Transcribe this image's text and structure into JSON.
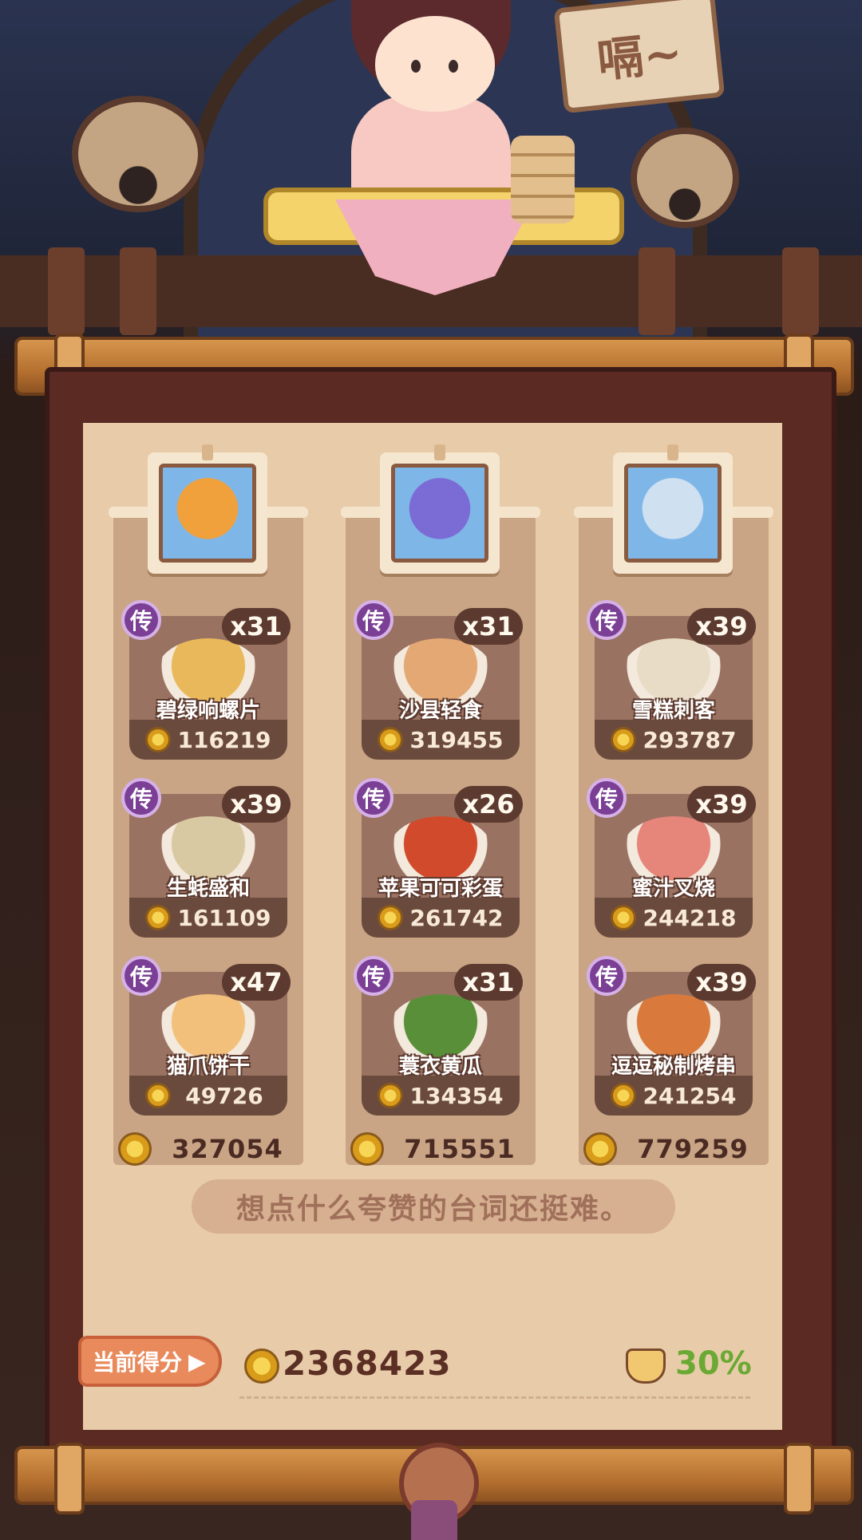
{
  "sign": {
    "text": "嗝~"
  },
  "rarity_badge": "传",
  "columns": [
    {
      "character": "bear-character",
      "total": "327054",
      "dishes": [
        {
          "name": "碧绿响螺片",
          "count": "x31",
          "price": "116219",
          "color": "#e9b85a"
        },
        {
          "name": "生蚝盛和",
          "count": "x39",
          "price": "161109",
          "color": "#d8c9a3"
        },
        {
          "name": "猫爪饼干",
          "count": "x47",
          "price": "49726",
          "color": "#f2c07a"
        }
      ]
    },
    {
      "character": "blue-haired-character",
      "total": "715551",
      "dishes": [
        {
          "name": "沙县轻食",
          "count": "x31",
          "price": "319455",
          "color": "#e3a873"
        },
        {
          "name": "苹果可可彩蛋",
          "count": "x26",
          "price": "261742",
          "color": "#d24a2c"
        },
        {
          "name": "蓑衣黄瓜",
          "count": "x31",
          "price": "134354",
          "color": "#5a8f3a"
        }
      ]
    },
    {
      "character": "white-haired-character",
      "total": "779259",
      "dishes": [
        {
          "name": "雪糕刺客",
          "count": "x39",
          "price": "293787",
          "color": "#e9dcc6"
        },
        {
          "name": "蜜汁叉烧",
          "count": "x39",
          "price": "244218",
          "color": "#e6857a"
        },
        {
          "name": "逗逗秘制烤串",
          "count": "x39",
          "price": "241254",
          "color": "#d97a3c"
        }
      ]
    }
  ],
  "speech": "想点什么夸赞的台词还挺难。",
  "score": {
    "label": "当前得分",
    "value": "2368423",
    "percent": "30%"
  },
  "colors": {
    "frame": "#5a2a23",
    "paper": "#e8cba9",
    "badge": "#7b4095",
    "percent": "#6aa933"
  }
}
